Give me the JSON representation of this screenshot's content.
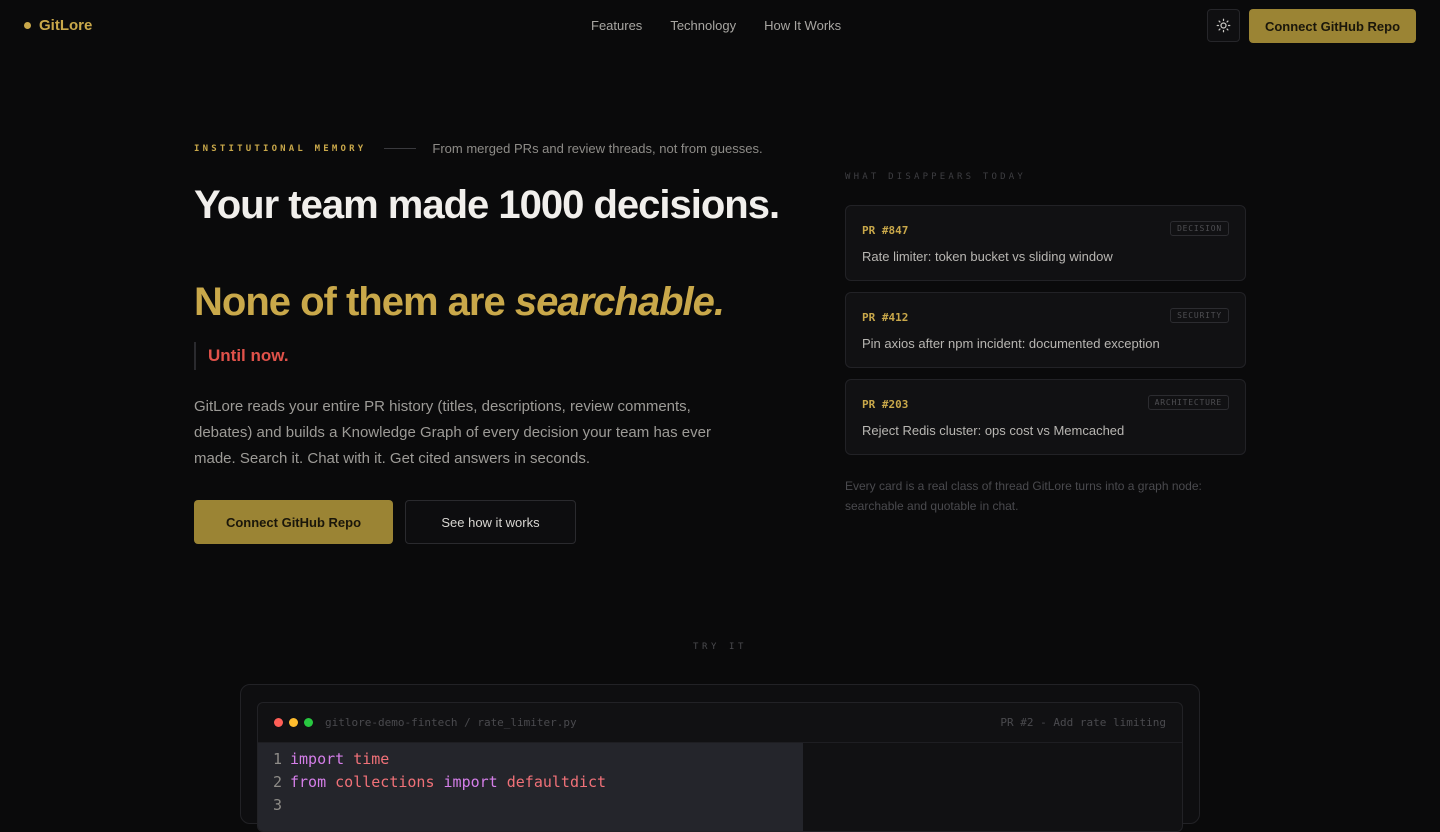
{
  "nav": {
    "brand": "GitLore",
    "links": [
      "Features",
      "Technology",
      "How It Works"
    ],
    "cta": "Connect GitHub Repo"
  },
  "hero": {
    "eyebrow": "INSTITUTIONAL MEMORY",
    "eyebrow_sub": "From merged PRs and review threads, not from guesses.",
    "title_line1": "Your team made 1000 decisions.",
    "title_gold_plain": "None of them are ",
    "title_gold_italic": "searchable.",
    "until_now": "Until now.",
    "description": "GitLore reads your entire PR history (titles, descriptions, review comments, debates) and builds a Knowledge Graph of every decision your team has ever made. Search it. Chat with it. Get cited answers in seconds.",
    "primary_button": "Connect GitHub Repo",
    "secondary_button": "See how it works"
  },
  "sidebar": {
    "label": "WHAT DISAPPEARS TODAY",
    "cards": [
      {
        "pr": "PR #847",
        "tag": "DECISION",
        "title": "Rate limiter: token bucket vs sliding window"
      },
      {
        "pr": "PR #412",
        "tag": "SECURITY",
        "title": "Pin axios after npm incident: documented exception"
      },
      {
        "pr": "PR #203",
        "tag": "ARCHITECTURE",
        "title": "Reject Redis cluster: ops cost vs Memcached"
      }
    ],
    "footnote": "Every card is a real class of thread GitLore turns into a graph node: searchable and quotable in chat."
  },
  "demo": {
    "label": "TRY IT",
    "file_path": "gitlore-demo-fintech / rate_limiter.py",
    "pr_ref": "PR #2 - Add rate limiting",
    "lines": [
      {
        "num": "1",
        "kw1": "import",
        "id1": "time",
        "kw2": "",
        "id2": ""
      },
      {
        "num": "2",
        "kw1": "from",
        "id1": "collections",
        "kw2": "import",
        "id2": "defaultdict"
      },
      {
        "num": "3",
        "kw1": "",
        "id1": "",
        "kw2": "",
        "id2": ""
      }
    ]
  },
  "colors": {
    "accent_gold": "#c9a84a",
    "button_gold": "#9b8434",
    "alert_red": "#e0524a",
    "background": "#0a0a0b"
  }
}
